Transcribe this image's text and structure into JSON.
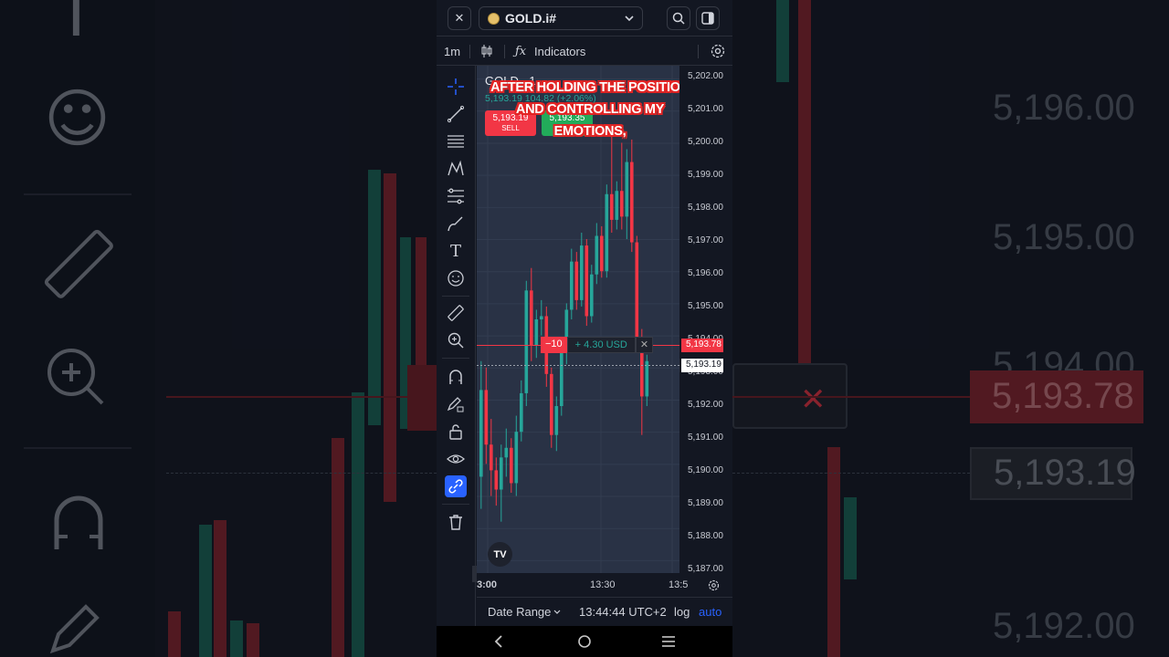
{
  "topbar": {
    "symbol": "GOLD.i#",
    "close_glyph": "✕"
  },
  "toolbar": {
    "interval": "1m",
    "indicators_label": "Indicators"
  },
  "legend": {
    "title": "GOLD · 1",
    "ohlc": "5,193.19  104.82 (+2.06%)"
  },
  "sell": {
    "price": "5,193.19",
    "label": "SELL"
  },
  "buy": {
    "price": "5,193.35",
    "label": "BUY"
  },
  "caption": {
    "line1": "AFTER HOLDING THE POSITION",
    "line2": "AND CONTROLLING MY",
    "line3": "EMOTIONS,"
  },
  "position": {
    "qty": "−10",
    "pl": "+ 4.30 USD",
    "close": "✕"
  },
  "price_axis": {
    "labels": [
      "5,202.00",
      "5,201.00",
      "5,200.00",
      "5,199.00",
      "5,198.00",
      "5,197.00",
      "5,196.00",
      "5,195.00",
      "5,194.00",
      "5,193.00",
      "5,192.00",
      "5,191.00",
      "5,190.00",
      "5,189.00",
      "5,188.00",
      "5,187.00"
    ],
    "position_tag": "5,193.78",
    "last_tag": "5,193.19"
  },
  "time_axis": {
    "t1": "3:00",
    "t2": "13:30",
    "t3": "13:5"
  },
  "bottom": {
    "date_range": "Date Range",
    "clock": "13:44:44 UTC+2",
    "log": "log",
    "auto": "auto"
  },
  "tv_logo": "TV",
  "background": {
    "prices": [
      "5,196.00",
      "5,195.00",
      "5,194.00",
      "5,193.78",
      "5,193.19",
      "5,192.00"
    ]
  },
  "colors": {
    "up": "#26a69a",
    "down": "#f23645",
    "accent": "#2962ff",
    "caption_outline": "#e22424"
  },
  "chart_data": {
    "type": "candlestick",
    "title": "GOLD · 1",
    "ylim": [
      5186.6,
      5202.4
    ],
    "candles": [
      [
        5189.6,
        5193.2,
        5188.6,
        5192.3
      ],
      [
        5192.3,
        5193.0,
        5190.0,
        5190.6
      ],
      [
        5190.6,
        5191.4,
        5189.0,
        5189.8
      ],
      [
        5189.8,
        5190.2,
        5188.7,
        5189.2
      ],
      [
        5189.2,
        5190.6,
        5188.2,
        5190.2
      ],
      [
        5190.2,
        5191.1,
        5189.6,
        5190.5
      ],
      [
        5190.5,
        5190.8,
        5189.1,
        5189.4
      ],
      [
        5189.4,
        5191.5,
        5189.0,
        5191.0
      ],
      [
        5191.0,
        5192.6,
        5190.7,
        5192.2
      ],
      [
        5192.2,
        5195.7,
        5191.8,
        5195.4
      ],
      [
        5195.4,
        5196.1,
        5193.2,
        5193.7
      ],
      [
        5193.7,
        5194.8,
        5193.3,
        5194.5
      ],
      [
        5194.5,
        5195.1,
        5194.0,
        5194.6
      ],
      [
        5194.6,
        5194.9,
        5192.4,
        5192.8
      ],
      [
        5192.8,
        5193.0,
        5190.5,
        5190.9
      ],
      [
        5190.9,
        5192.1,
        5190.4,
        5191.8
      ],
      [
        5191.8,
        5193.9,
        5191.5,
        5193.5
      ],
      [
        5193.5,
        5195.0,
        5193.1,
        5194.8
      ],
      [
        5194.8,
        5196.7,
        5194.5,
        5196.3
      ],
      [
        5196.3,
        5196.6,
        5194.8,
        5195.1
      ],
      [
        5195.1,
        5197.2,
        5194.9,
        5196.8
      ],
      [
        5196.8,
        5197.0,
        5194.3,
        5194.6
      ],
      [
        5194.6,
        5196.2,
        5194.4,
        5195.9
      ],
      [
        5195.9,
        5197.5,
        5195.6,
        5197.1
      ],
      [
        5197.1,
        5197.4,
        5195.8,
        5196.0
      ],
      [
        5196.0,
        5198.7,
        5195.8,
        5198.4
      ],
      [
        5198.4,
        5200.5,
        5197.2,
        5197.6
      ],
      [
        5197.6,
        5198.8,
        5197.3,
        5198.5
      ],
      [
        5198.5,
        5200.0,
        5197.3,
        5197.7
      ],
      [
        5197.7,
        5199.8,
        5197.0,
        5199.4
      ],
      [
        5199.4,
        5200.1,
        5196.6,
        5196.9
      ],
      [
        5196.9,
        5197.1,
        5193.6,
        5193.8
      ],
      [
        5193.8,
        5194.2,
        5190.9,
        5192.1
      ],
      [
        5192.1,
        5193.4,
        5191.8,
        5193.2
      ]
    ]
  }
}
